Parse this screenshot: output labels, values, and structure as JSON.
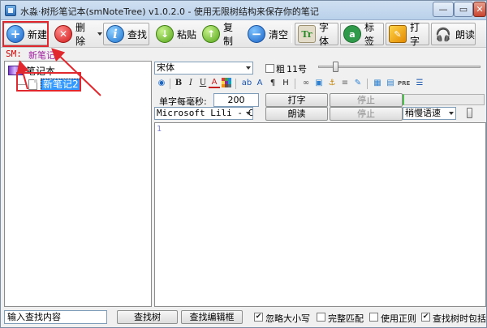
{
  "window": {
    "title": "水淼·树形笔记本(smNoteTree) v1.0.2.0 - 使用无限树结构来保存你的笔记",
    "min_glyph": "—",
    "max_glyph": "▭",
    "close_glyph": "✕"
  },
  "toolbar": {
    "new_label": "新建",
    "delete_label": "删除",
    "find_label": "查找",
    "paste_label": "粘贴",
    "copy_label": "复制",
    "clear_label": "清空",
    "font_label": "字体",
    "tag_label": "标签",
    "type_label": "打字",
    "read_label": "朗读"
  },
  "path": {
    "prefix": "SM:",
    "value": "新笔记2"
  },
  "tree": {
    "root_label": "笔记本",
    "child_label": "新笔记2"
  },
  "editor": {
    "font_name": "宋体",
    "bold_label": "粗",
    "font_size": "11号",
    "bold_checked": false,
    "format_buttons": [
      "B",
      "I",
      "U",
      "A",
      "ab",
      "A",
      "¶",
      "H"
    ],
    "ms_per_char_label": "单字每毫秒:",
    "ms_per_char_value": "200",
    "type_button": "打字",
    "stop_button_1": "停止",
    "voice_name": "Microsoft Lili - Chi",
    "read_button": "朗读",
    "stop_button_2": "停止",
    "speed_label": "稍慢语速",
    "first_line_number": "1"
  },
  "search": {
    "placeholder": "输入查找内容",
    "find_tree_button": "查找树",
    "find_editor_button": "查找编辑框",
    "ignore_case_label": "忽略大小写",
    "ignore_case_checked": true,
    "whole_match_label": "完整匹配",
    "whole_match_checked": false,
    "regex_label": "使用正则",
    "regex_checked": false,
    "include_tree_label": "查找树时包括",
    "include_tree_checked": true
  },
  "colors": {
    "annotation": "#e0282e",
    "path_prefix": "#cc0000",
    "path_value": "#a020a0",
    "selection": "#3399ff"
  }
}
